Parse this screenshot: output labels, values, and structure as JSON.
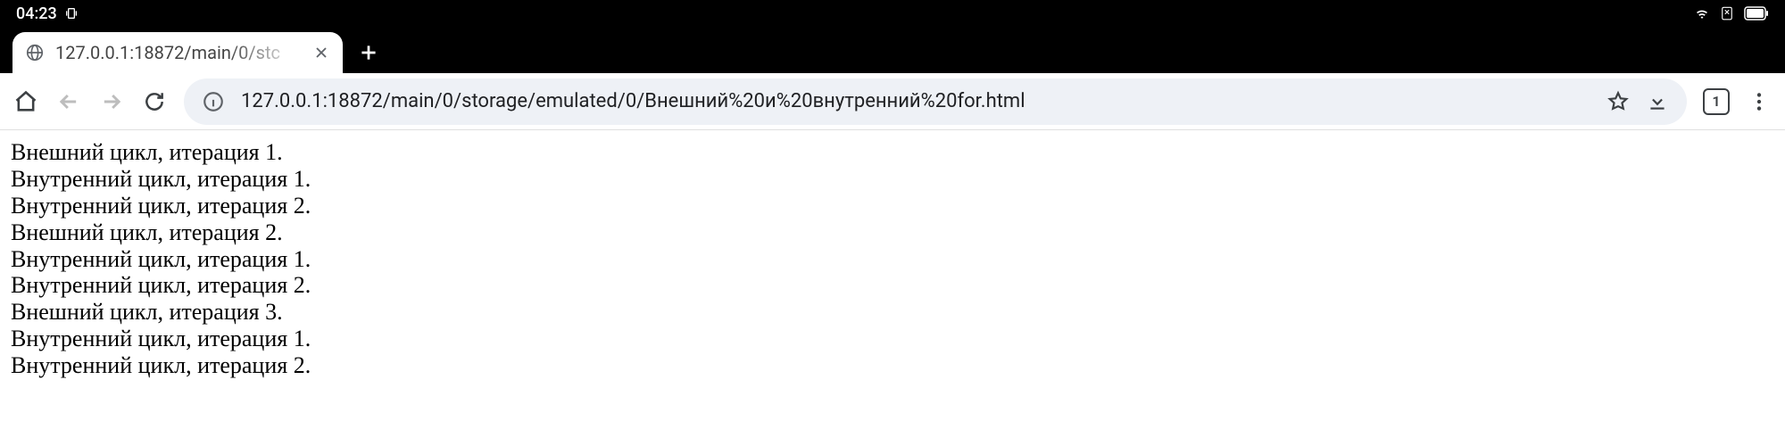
{
  "statusbar": {
    "time": "04:23"
  },
  "tab": {
    "title": "127.0.0.1:18872/main/0/stc"
  },
  "address": {
    "url": "127.0.0.1:18872/main/0/storage/emulated/0/Внешний%20и%20внутренний%20for.html"
  },
  "tabcount": "1",
  "content": {
    "lines": [
      "Внешний цикл, итерация 1.",
      "Внутренний цикл, итерация 1.",
      "Внутренний цикл, итерация 2.",
      "Внешний цикл, итерация 2.",
      "Внутренний цикл, итерация 1.",
      "Внутренний цикл, итерация 2.",
      "Внешний цикл, итерация 3.",
      "Внутренний цикл, итерация 1.",
      "Внутренний цикл, итерация 2."
    ]
  }
}
